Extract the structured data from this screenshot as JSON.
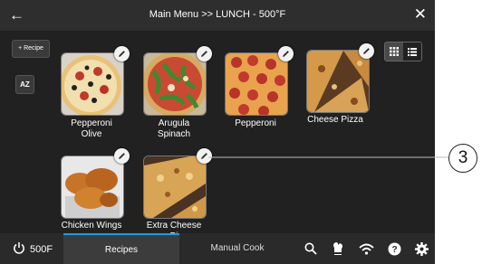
{
  "header": {
    "back_icon": "arrow-left-icon",
    "title": "Main Menu >> LUNCH - 500°F",
    "close_icon": "close-icon"
  },
  "sidebar": {
    "add_recipe_label": "+ Recipe",
    "sort_label": "AZ"
  },
  "view_toggle": {
    "grid_icon": "grid-view-icon",
    "list_icon": "list-view-icon",
    "selected": "grid"
  },
  "recipes": [
    {
      "name": "Pepperoni\nOlive"
    },
    {
      "name": "Arugula\nSpinach"
    },
    {
      "name": "Pepperoni"
    },
    {
      "name": "Cheese Pizza"
    },
    {
      "name": "Chicken Wings"
    },
    {
      "name": "Extra Cheese\nPi"
    }
  ],
  "bottom_bar": {
    "power_icon": "power-icon",
    "temperature": "500F",
    "tabs": [
      {
        "label": "Recipes",
        "active": true
      },
      {
        "label": "Manual Cook",
        "active": false
      }
    ],
    "icons": [
      "search-icon",
      "oven-mitt-icon",
      "wifi-icon",
      "help-icon",
      "gear-icon"
    ]
  },
  "callout": {
    "number": "3"
  },
  "colors": {
    "accent": "#1a9be6",
    "background": "#212121"
  }
}
